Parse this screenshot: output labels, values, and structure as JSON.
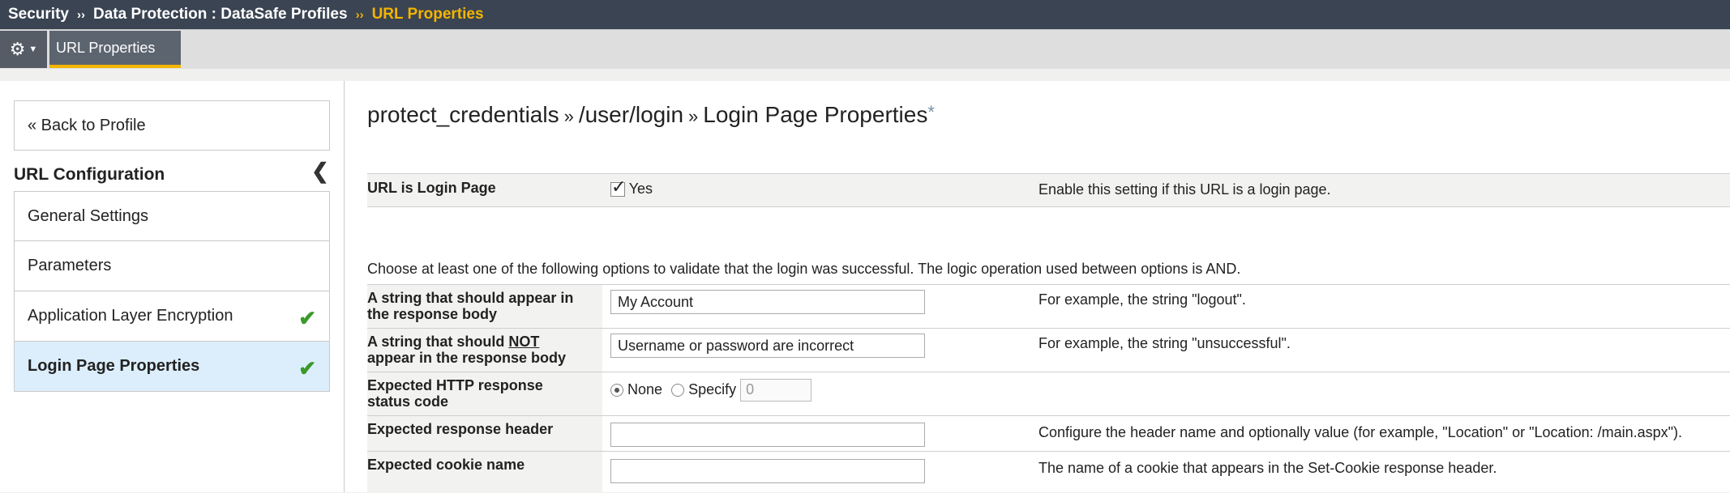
{
  "breadcrumb": {
    "items": [
      "Security",
      "Data Protection : DataSafe Profiles",
      "URL Properties"
    ],
    "separator": "››"
  },
  "tabs": {
    "active_label": "URL Properties"
  },
  "sidebar": {
    "back_label": "« Back to Profile",
    "section_title": "URL Configuration",
    "items": [
      {
        "label": "General Settings",
        "complete": false
      },
      {
        "label": "Parameters",
        "complete": false
      },
      {
        "label": "Application Layer Encryption",
        "complete": true
      },
      {
        "label": "Login Page Properties",
        "complete": true,
        "selected": true
      }
    ]
  },
  "page": {
    "title_parts": [
      "protect_credentials",
      "/user/login",
      "Login Page Properties"
    ],
    "title_sep": "»",
    "required_marker": "*"
  },
  "form": {
    "login_page": {
      "label": "URL is Login Page",
      "checked": true,
      "value_label": "Yes",
      "help": "Enable this setting if this URL is a login page."
    },
    "intro": "Choose at least one of the following options to validate that the login was successful. The logic operation used between options is AND.",
    "appear": {
      "label_line1": "A string that should appear in",
      "label_line2": "the response body",
      "value": "My Account",
      "help": "For example, the string \"logout\"."
    },
    "not_appear": {
      "label_pre": "A string that should ",
      "label_emph": "NOT",
      "label_line2": "appear in the response body",
      "value": "Username or password are incorrect",
      "help": "For example, the string \"unsuccessful\"."
    },
    "status_code": {
      "label_line1": "Expected HTTP response",
      "label_line2": "status code",
      "option_none": "None",
      "option_specify": "Specify",
      "selected": "None",
      "specify_value": "0"
    },
    "response_header": {
      "label": "Expected response header",
      "value": "",
      "help": "Configure the header name and optionally value (for example, \"Location\" or \"Location: /main.aspx\")."
    },
    "cookie_name": {
      "label": "Expected cookie name",
      "value": "",
      "help": "The name of a cookie that appears in the Set-Cookie response header."
    }
  },
  "colors": {
    "accent": "#f4b400",
    "topbar": "#3a4452",
    "selected_nav": "#dceefb",
    "check": "#3a9a2a"
  },
  "icons": {
    "gear": "gear-icon",
    "collapse": "chevron-left-icon",
    "check": "check-icon"
  }
}
